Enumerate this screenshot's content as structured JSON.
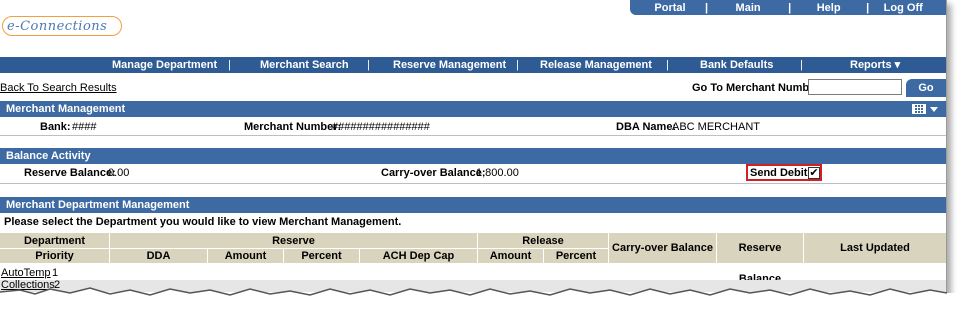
{
  "top_nav": [
    "Portal",
    "Main",
    "Help",
    "Log Off"
  ],
  "logo_text": "e-Connections",
  "main_nav": [
    {
      "label": "Manage Department"
    },
    {
      "label": "Merchant Search"
    },
    {
      "label": "Reserve Management"
    },
    {
      "label": "Release Management"
    },
    {
      "label": "Bank Defaults"
    },
    {
      "label": "Reports ▾"
    }
  ],
  "back_link": "Back To Search Results",
  "goto": {
    "label": "Go To Merchant Number:",
    "value": "",
    "button": "Go"
  },
  "merchant_management": {
    "title": "Merchant Management",
    "bank_label": "Bank:",
    "bank_value": "####",
    "merchant_number_label": "Merchant Number:",
    "merchant_number_value": "################",
    "dba_label": "DBA Name:",
    "dba_value": "ABC MERCHANT"
  },
  "balance_activity": {
    "title": "Balance Activity",
    "reserve_label": "Reserve Balance:",
    "reserve_value": "0.00",
    "carryover_label": "Carry-over Balance:",
    "carryover_value": "1,800.00",
    "send_debit_label": "Send Debit:",
    "send_debit_checked": true
  },
  "department_management": {
    "title": "Merchant Department Management",
    "instruction": "Please select the Department you would like to view Merchant Management.",
    "header_row1": {
      "department": "Department",
      "reserve": "Reserve",
      "release": "Release",
      "carryover": "Carry-over Balance",
      "reserve_balance": "Reserve Balance",
      "last_updated": "Last Updated"
    },
    "header_row2": {
      "priority": "Priority",
      "dda": "DDA",
      "amount": "Amount",
      "percent": "Percent",
      "ach": "ACH Dep Cap",
      "rel_amount": "Amount",
      "rel_percent": "Percent"
    },
    "rows": [
      {
        "department": "AutoTemp",
        "priority": "1"
      },
      {
        "department": "Collections",
        "priority": "2"
      }
    ]
  },
  "colors": {
    "nav_blue": "#3d6aa3",
    "header_tan": "#d9d4bd",
    "highlight_red": "#d02020"
  }
}
